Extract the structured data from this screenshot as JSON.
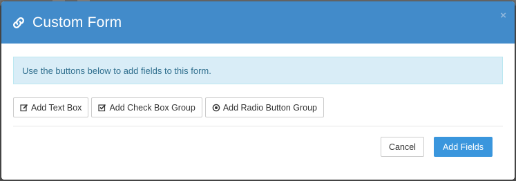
{
  "modal": {
    "title": "Custom Form",
    "close_label": "×"
  },
  "alert": {
    "text": "Use the buttons below to add fields to this form."
  },
  "field_buttons": {
    "text_box": "Add Text Box",
    "check_box_group": "Add Check Box Group",
    "radio_group": "Add Radio Button Group"
  },
  "footer": {
    "cancel_label": "Cancel",
    "submit_label": "Add Fields"
  },
  "icons": {
    "header": "link-icon",
    "text_box": "edit-icon",
    "check_box_group": "checkbox-checked-icon",
    "radio_group": "radio-dot-icon"
  },
  "colors": {
    "header_bg": "#428bca",
    "alert_bg": "#d9edf7",
    "alert_text": "#31708f",
    "primary": "#3a96dd"
  }
}
